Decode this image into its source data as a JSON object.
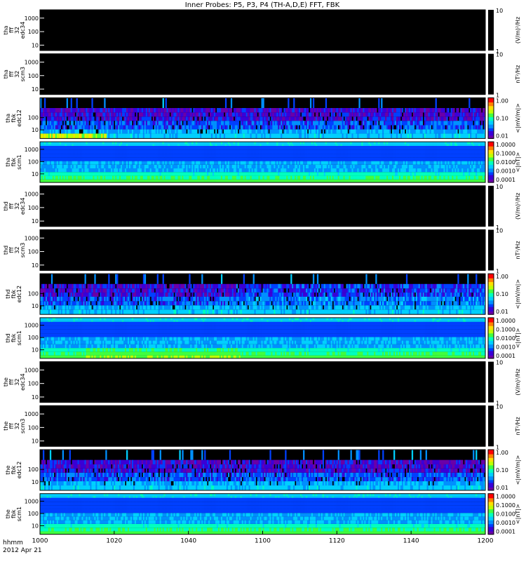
{
  "chart_data": {
    "type": "heatmap",
    "title": "Inner Probes: P5, P3, P4 (TH-A,D,E) FFT, FBK",
    "x_axis": {
      "label_line1": "hhmm",
      "label_line2": "2012 Apr 21",
      "ticks": [
        "1000",
        "1020",
        "1040",
        "1100",
        "1120",
        "1140",
        "1200"
      ],
      "range_minutes": [
        0,
        120
      ]
    },
    "colorbar_palette": [
      "#6a00a8",
      "#3a00d8",
      "#0040ff",
      "#0090ff",
      "#00d0ff",
      "#00ffc0",
      "#40ff40",
      "#c0ff00",
      "#ffe000",
      "#ff8000",
      "#ff0000"
    ],
    "panels": [
      {
        "probe": "tha",
        "label": [
          "tha",
          "fff",
          "32",
          "edc34"
        ],
        "yticks": [
          "1000",
          "100",
          "10"
        ],
        "ylim": [
          4,
          4096
        ],
        "cbar_ticks": [
          "10",
          "1"
        ],
        "cbar_label": "(V/m)²/Hz",
        "content": "none"
      },
      {
        "probe": "tha",
        "label": [
          "tha",
          "fff",
          "32",
          "scm3"
        ],
        "yticks": [
          "1000",
          "100",
          "10"
        ],
        "ylim": [
          4,
          4096
        ],
        "cbar_ticks": [
          "10",
          "1"
        ],
        "cbar_label": "nT²/Hz",
        "content": "none"
      },
      {
        "probe": "tha",
        "label": [
          "tha",
          "fbk",
          "edc12"
        ],
        "yticks": [
          "100",
          "10"
        ],
        "ylim": [
          2,
          4096
        ],
        "cbar_ticks": [
          "1.00",
          "0.10",
          "0.01"
        ],
        "cbar_label": "<|mV/m|>",
        "content": "efield"
      },
      {
        "probe": "tha",
        "label": [
          "tha",
          "fbk",
          "scm1"
        ],
        "yticks": [
          "1000",
          "100",
          "10"
        ],
        "ylim": [
          2,
          4096
        ],
        "cbar_ticks": [
          "1.0000",
          "0.1000",
          "0.0100",
          "0.0010",
          "0.0001"
        ],
        "cbar_label": "<|nT|>",
        "content": "bfield"
      },
      {
        "probe": "thd",
        "label": [
          "thd",
          "fff",
          "32",
          "edc34"
        ],
        "yticks": [
          "1000",
          "100",
          "10"
        ],
        "ylim": [
          4,
          4096
        ],
        "cbar_ticks": [
          "10",
          "1"
        ],
        "cbar_label": "(V/m)²/Hz",
        "content": "none"
      },
      {
        "probe": "thd",
        "label": [
          "thd",
          "fff",
          "32",
          "scm3"
        ],
        "yticks": [
          "1000",
          "100",
          "10"
        ],
        "ylim": [
          4,
          4096
        ],
        "cbar_ticks": [
          "10",
          "1"
        ],
        "cbar_label": "nT²/Hz",
        "content": "none"
      },
      {
        "probe": "thd",
        "label": [
          "thd",
          "fbk",
          "edc12"
        ],
        "yticks": [
          "100",
          "10"
        ],
        "ylim": [
          2,
          4096
        ],
        "cbar_ticks": [
          "1.00",
          "0.10",
          "0.01"
        ],
        "cbar_label": "<|mV/m|>",
        "content": "efield"
      },
      {
        "probe": "thd",
        "label": [
          "thd",
          "fbk",
          "scm1"
        ],
        "yticks": [
          "1000",
          "100",
          "10"
        ],
        "ylim": [
          2,
          4096
        ],
        "cbar_ticks": [
          "1.0000",
          "0.1000",
          "0.0100",
          "0.0010",
          "0.0001"
        ],
        "cbar_label": "<|nT|>",
        "content": "bfield"
      },
      {
        "probe": "the",
        "label": [
          "the",
          "fff",
          "32",
          "edc34"
        ],
        "yticks": [
          "1000",
          "100",
          "10"
        ],
        "ylim": [
          4,
          4096
        ],
        "cbar_ticks": [
          "10",
          "1"
        ],
        "cbar_label": "(V/m)²/Hz",
        "content": "none"
      },
      {
        "probe": "the",
        "label": [
          "the",
          "fff",
          "32",
          "scm3"
        ],
        "yticks": [
          "1000",
          "100",
          "10"
        ],
        "ylim": [
          4,
          4096
        ],
        "cbar_ticks": [
          "10",
          "1"
        ],
        "cbar_label": "nT²/Hz",
        "content": "none"
      },
      {
        "probe": "the",
        "label": [
          "the",
          "fbk",
          "edc12"
        ],
        "yticks": [
          "100",
          "10"
        ],
        "ylim": [
          2,
          4096
        ],
        "cbar_ticks": [
          "1.00",
          "0.10",
          "0.01"
        ],
        "cbar_label": "<|mV/m|>",
        "content": "efield"
      },
      {
        "probe": "the",
        "label": [
          "the",
          "fbk",
          "scm1"
        ],
        "yticks": [
          "1000",
          "100",
          "10"
        ],
        "ylim": [
          2,
          4096
        ],
        "cbar_ticks": [
          "1.0000",
          "0.1000",
          "0.0100",
          "0.0010",
          "0.0001"
        ],
        "cbar_label": "<|nT|>",
        "content": "bfield"
      }
    ]
  }
}
